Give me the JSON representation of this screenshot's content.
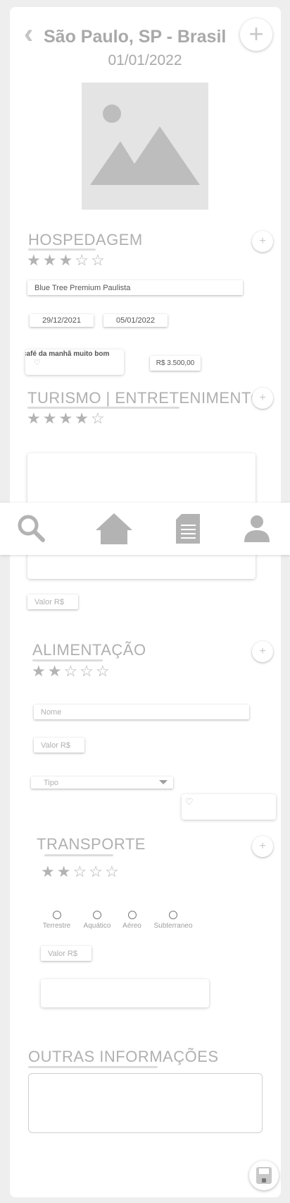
{
  "header": {
    "back_icon": "chevron-left-icon",
    "title": "São Paulo, SP - Brasil",
    "date": "01/01/2022",
    "add_icon": "plus-icon"
  },
  "hospedagem": {
    "title": "HOSPEDAGEM",
    "rating": 3,
    "max_rating": 5,
    "hotel_name": "Blue Tree  Premium Paulista",
    "checkin": "29/12/2021",
    "checkout": "05/01/2022",
    "note": "café da manhã muito bom",
    "price": "R$ 3.500,00"
  },
  "turismo": {
    "title": "TURISMO | ENTRETENIMENTO",
    "rating": 4,
    "max_rating": 5,
    "value_placeholder": "Valor R$"
  },
  "nav": {
    "items": [
      {
        "name": "search-icon"
      },
      {
        "name": "home-icon"
      },
      {
        "name": "document-icon"
      },
      {
        "name": "user-icon"
      }
    ]
  },
  "alimentacao": {
    "title": "ALIMENTAÇÃO",
    "rating": 2,
    "max_rating": 5,
    "name_placeholder": "Nome",
    "value_placeholder": "Valor R$",
    "type_placeholder": "Tipo"
  },
  "transporte": {
    "title": "TRANSPORTE",
    "rating": 2,
    "max_rating": 5,
    "options": [
      "Terrestre",
      "Aquático",
      "Aéreo",
      "Subterraneo"
    ],
    "value_placeholder": "Valor R$"
  },
  "outras": {
    "title": "OUTRAS INFORMAÇÕES"
  },
  "save_icon": "save-icon",
  "colors": {
    "background": "#eeeeee",
    "card": "#ffffff",
    "text_muted": "#a9a9a9",
    "icon_gray": "#b3b3b3"
  }
}
